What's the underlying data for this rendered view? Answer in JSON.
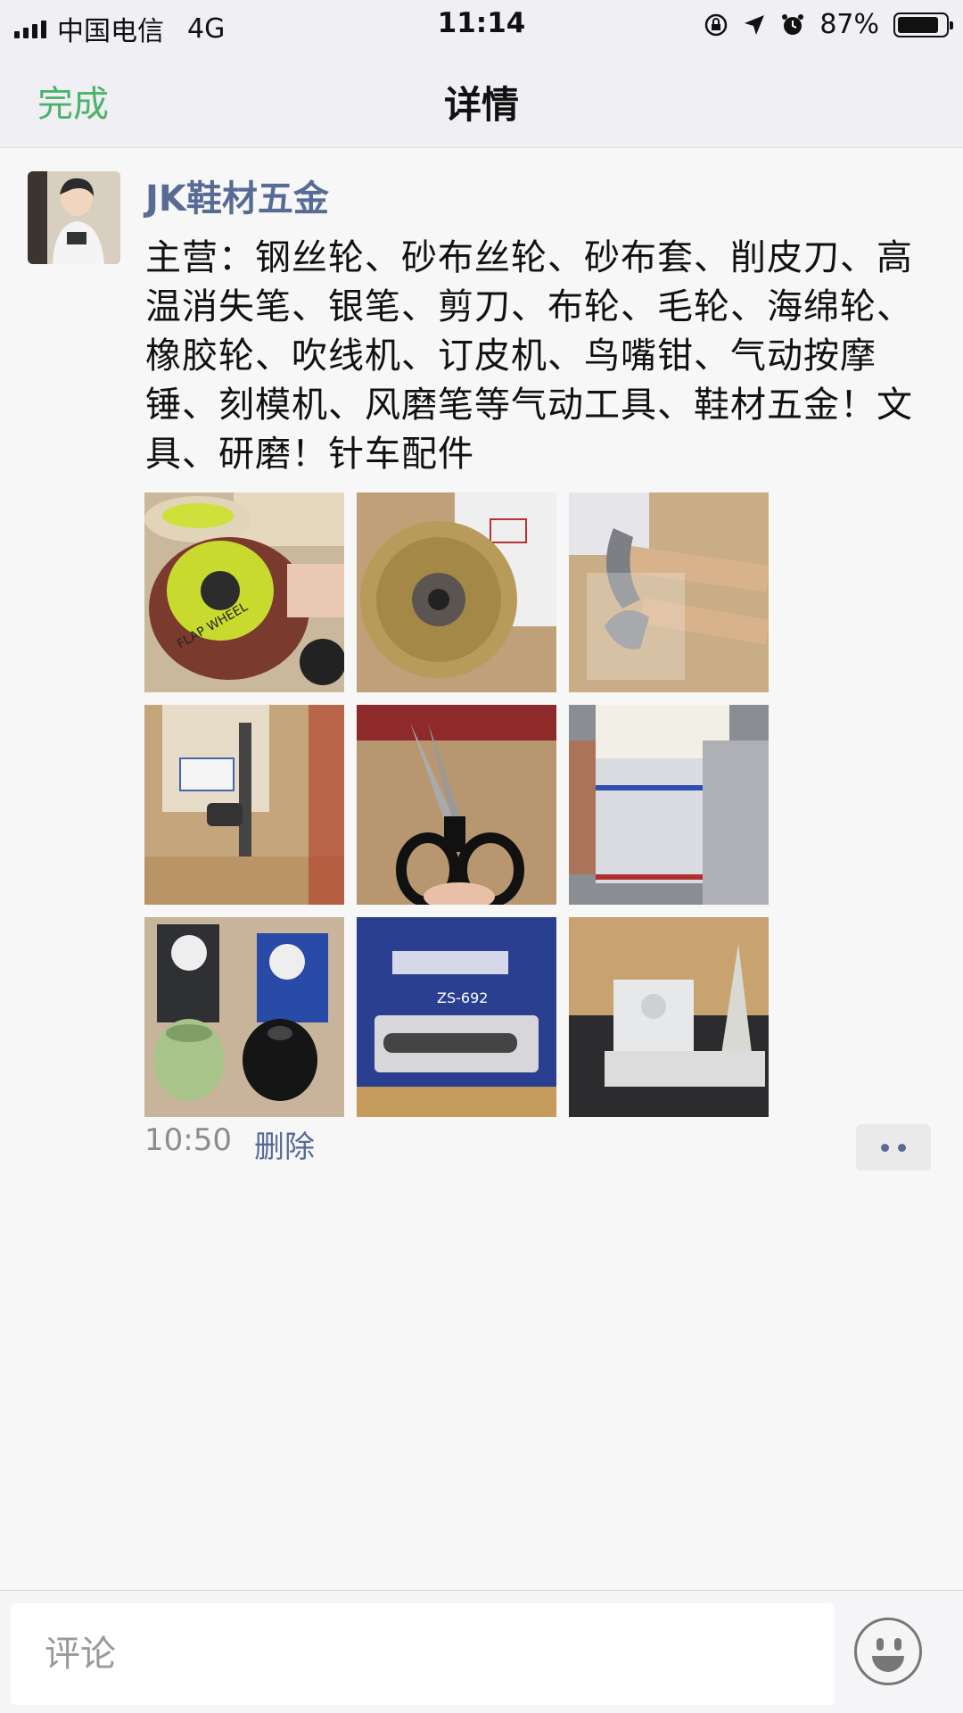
{
  "status_bar": {
    "carrier": "中国电信",
    "network": "4G",
    "time": "11:14",
    "battery_text": "87%",
    "battery_level": 0.87,
    "icons": [
      "signal-icon",
      "rotation-lock-icon",
      "location-arrow-icon",
      "alarm-icon",
      "battery-icon"
    ]
  },
  "nav": {
    "done_label": "完成",
    "title": "详情"
  },
  "post": {
    "author": "JK鞋材五金",
    "content": "主营：钢丝轮、砂布丝轮、砂布套、削皮刀、高温消失笔、银笔、剪刀、布轮、毛轮、海绵轮、橡胶轮、吹线机、订皮机、鸟嘴钳、气动按摩锤、刻模机、风磨笔等气动工具、鞋材五金！文具、研磨！针车配件",
    "time": "10:50",
    "delete_label": "删除",
    "photos": [
      {
        "name": "flap-wheel-photo",
        "label": "FLAP WHEEL"
      },
      {
        "name": "wire-wheel-photo"
      },
      {
        "name": "hammers-photo"
      },
      {
        "name": "rubber-hammer-photo"
      },
      {
        "name": "scissors-photo"
      },
      {
        "name": "silver-pens-photo"
      },
      {
        "name": "rubber-wheels-photo"
      },
      {
        "name": "pneumatic-hammer-box-photo",
        "label": "ZS-692"
      },
      {
        "name": "plastic-parts-photo"
      }
    ]
  },
  "comment": {
    "placeholder": "评论"
  },
  "colors": {
    "accent_green": "#4cb26b",
    "link_blue": "#576b95"
  }
}
